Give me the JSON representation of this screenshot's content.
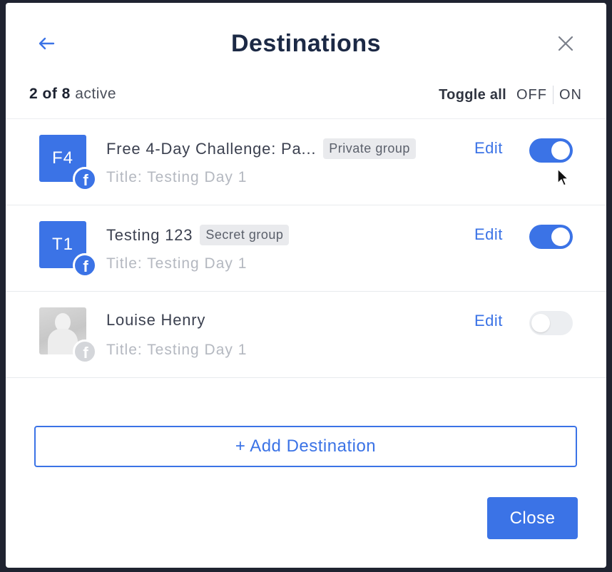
{
  "modal": {
    "title": "Destinations",
    "back_icon": "arrow-left-icon",
    "close_icon": "close-icon"
  },
  "summary": {
    "active_count": "2 of 8",
    "active_label": "active"
  },
  "toggle_all": {
    "label": "Toggle all",
    "off_label": "OFF",
    "on_label": "ON"
  },
  "destinations": [
    {
      "initials": "F4",
      "name": "Free 4-Day Challenge: Pa...",
      "badge": "Private group",
      "subtitle": "Title: Testing Day 1",
      "edit_label": "Edit",
      "enabled": true
    },
    {
      "initials": "T1",
      "name": "Testing 123",
      "badge": "Secret group",
      "subtitle": "Title: Testing Day 1",
      "edit_label": "Edit",
      "enabled": true
    },
    {
      "initials": "",
      "name": "Louise Henry",
      "badge": "",
      "subtitle": "Title: Testing Day 1",
      "edit_label": "Edit",
      "enabled": false
    }
  ],
  "actions": {
    "add_destination_label": "+ Add Destination",
    "close_label": "Close"
  },
  "colors": {
    "accent": "#3b73e6",
    "title": "#1c2945",
    "muted": "#b4b8c0",
    "toggle_off": "#eceef1"
  }
}
